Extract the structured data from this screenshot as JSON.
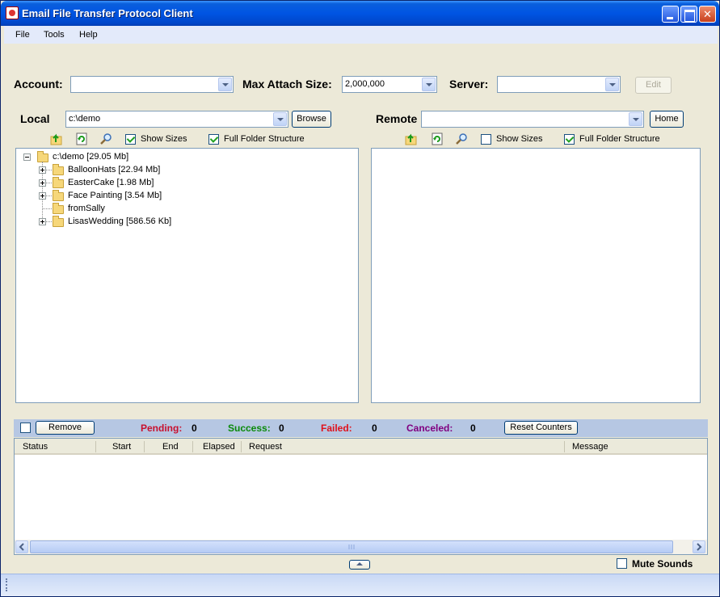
{
  "window": {
    "title": "Email File Transfer Protocol Client"
  },
  "menu": [
    {
      "label": "File"
    },
    {
      "label": "Tools"
    },
    {
      "label": "Help"
    }
  ],
  "toolbar": {
    "account_label": "Account:",
    "account_value": "",
    "max_attach_label": "Max Attach Size:",
    "max_attach_value": "2,000,000",
    "server_label": "Server:",
    "server_value": "",
    "edit_button": "Edit"
  },
  "local": {
    "label": "Local",
    "path": "c:\\demo",
    "browse_button": "Browse",
    "show_sizes_label": "Show Sizes",
    "show_sizes_checked": true,
    "full_folder_label": "Full Folder Structure",
    "full_folder_checked": true,
    "tree": {
      "root": "c:\\demo [29.05 Mb]",
      "children": [
        {
          "label": "BalloonHats [22.94 Mb]",
          "expandable": true
        },
        {
          "label": "EasterCake [1.98 Mb]",
          "expandable": true
        },
        {
          "label": "Face Painting [3.54 Mb]",
          "expandable": true
        },
        {
          "label": "fromSally",
          "expandable": false
        },
        {
          "label": "LisasWedding [586.56 Kb]",
          "expandable": true
        }
      ]
    }
  },
  "remote": {
    "label": "Remote",
    "path": "",
    "home_button": "Home",
    "show_sizes_label": "Show Sizes",
    "show_sizes_checked": false,
    "full_folder_label": "Full Folder Structure",
    "full_folder_checked": true
  },
  "queue": {
    "remove_button": "Remove",
    "pending_label": "Pending:",
    "pending_value": "0",
    "success_label": "Success:",
    "success_value": "0",
    "failed_label": "Failed:",
    "failed_value": "0",
    "canceled_label": "Canceled:",
    "canceled_value": "0",
    "reset_button": "Reset Counters",
    "columns": [
      "Status",
      "Start",
      "End",
      "Elapsed",
      "Request",
      "Message"
    ]
  },
  "footer": {
    "mute_label": "Mute Sounds",
    "mute_checked": false
  },
  "colors": {
    "pending": "#c8102e",
    "success": "#0a8a0a",
    "failed": "#e0101a",
    "canceled": "#800080",
    "title_bar": "#0054e3"
  }
}
